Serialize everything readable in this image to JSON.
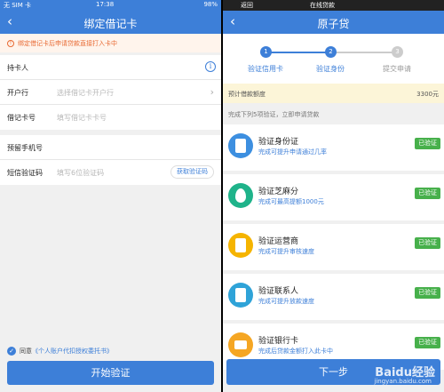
{
  "left": {
    "status": {
      "carrier": "无 SIM 卡",
      "time": "17:38",
      "battery": "98%"
    },
    "nav_title": "绑定借记卡",
    "warning": "绑定借记卡后申请贷款直接打入卡中",
    "rows": [
      {
        "label": "持卡人",
        "placeholder": ""
      },
      {
        "label": "开户行",
        "placeholder": "选择借记卡开户行"
      },
      {
        "label": "借记卡号",
        "placeholder": "填写借记卡卡号"
      }
    ],
    "rows2": [
      {
        "label": "预留手机号",
        "placeholder": ""
      },
      {
        "label": "短信验证码",
        "placeholder": "填写6位验证码"
      }
    ],
    "code_button": "获取验证码",
    "agree_prefix": "同意",
    "agree_link": "《个人账户代扣授权委托书》",
    "main_button": "开始验证"
  },
  "right": {
    "nav_title_top": "在线贷款",
    "nav_back": "返回",
    "nav_title": "原子贷",
    "steps": [
      {
        "num": "1",
        "label": "验证信用卡",
        "state": "done"
      },
      {
        "num": "2",
        "label": "验证身份",
        "state": "active"
      },
      {
        "num": "3",
        "label": "提交申请",
        "state": "pending"
      }
    ],
    "quota_label": "预计借款额度",
    "quota_value": "3300元",
    "hint": "完成下列5项验证，立即申请贷款",
    "items": [
      {
        "title": "验证身份证",
        "sub": "完成可提升申请通过几率",
        "badge": "已验证",
        "icon": "id-card-icon",
        "color": "#3d8fe0"
      },
      {
        "title": "验证芝麻分",
        "sub": "完成可最高提额1000元",
        "badge": "已验证",
        "icon": "sesame-icon",
        "color": "#1fb38a"
      },
      {
        "title": "验证运营商",
        "sub": "完成可提升审核速度",
        "badge": "已验证",
        "icon": "phone-icon",
        "color": "#f5b400"
      },
      {
        "title": "验证联系人",
        "sub": "完成可提升放款速度",
        "badge": "已验证",
        "icon": "contacts-icon",
        "color": "#2fa3d8"
      },
      {
        "title": "验证银行卡",
        "sub": "完成后贷款金额打入此卡中",
        "badge": "已验证",
        "icon": "bank-card-icon",
        "color": "#f5a623"
      }
    ],
    "next_button": "下一步",
    "watermark": "Baidu经验",
    "watermark_sub": "jingyan.baidu.com"
  },
  "colors": {
    "primary": "#3d7fd8",
    "success": "#47b04b",
    "warning": "#e86a33",
    "step_pending": "#cccccc"
  }
}
